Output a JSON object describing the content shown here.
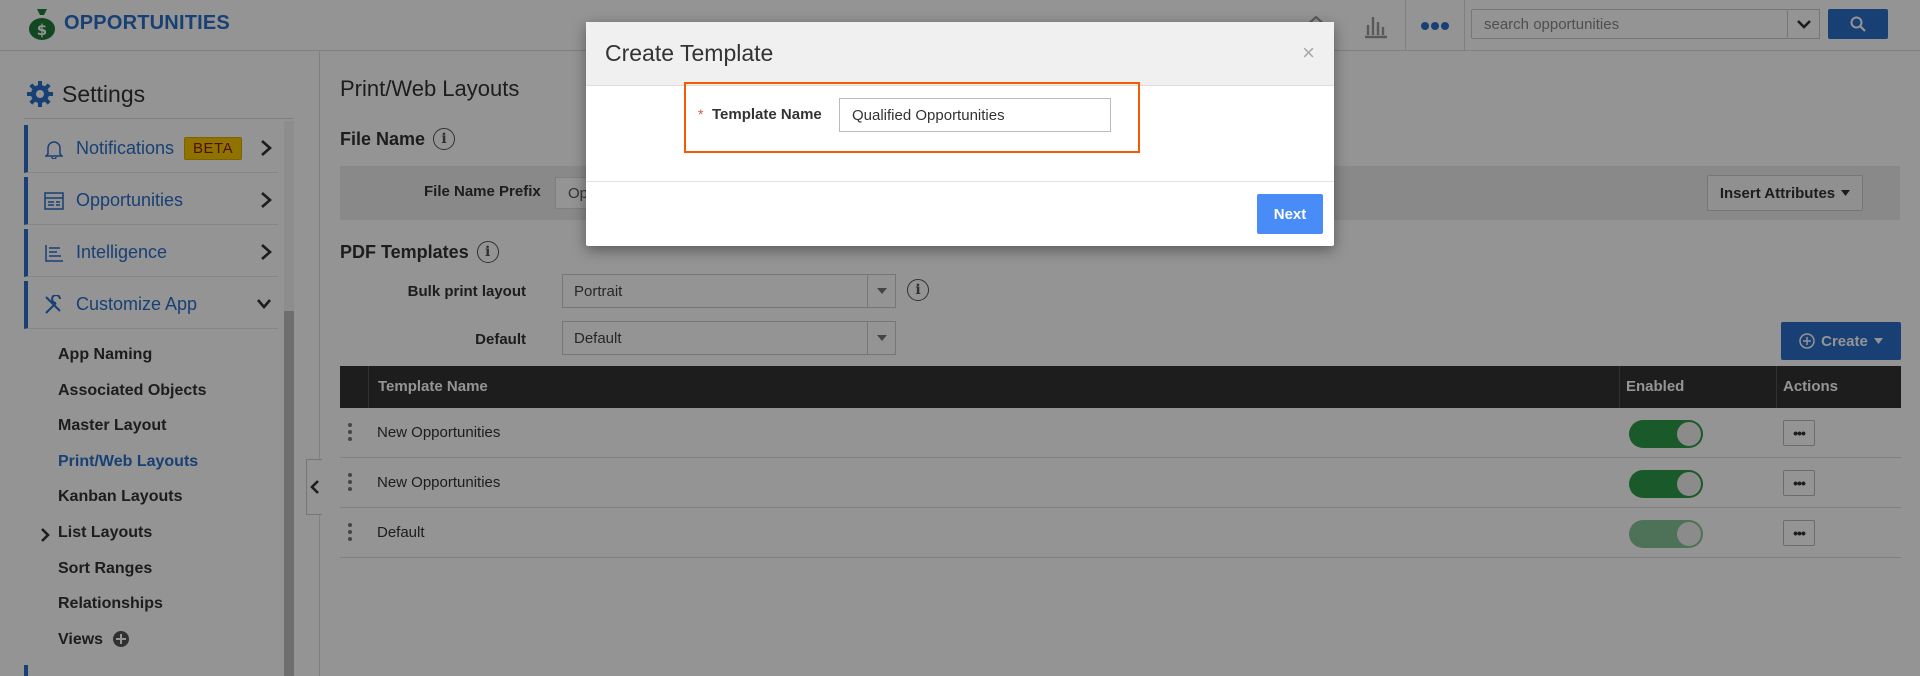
{
  "header": {
    "app_title": "OPPORTUNITIES",
    "search_placeholder": "search opportunities",
    "accent_color": "#2a6fc9"
  },
  "sidebar": {
    "title": "Settings",
    "items": [
      {
        "label": "Notifications",
        "badge": "BETA",
        "icon": "bell-icon",
        "expanded": false
      },
      {
        "label": "Opportunities",
        "icon": "table-icon",
        "expanded": false
      },
      {
        "label": "Intelligence",
        "icon": "lines-icon",
        "expanded": false
      },
      {
        "label": "Customize App",
        "icon": "tools-icon",
        "expanded": true
      }
    ],
    "sub_items": [
      {
        "label": "App Naming"
      },
      {
        "label": "Associated Objects"
      },
      {
        "label": "Master Layout"
      },
      {
        "label": "Print/Web Layouts",
        "active": true
      },
      {
        "label": "Kanban Layouts"
      },
      {
        "label": "List Layouts",
        "has_children": true
      },
      {
        "label": "Sort Ranges"
      },
      {
        "label": "Relationships"
      },
      {
        "label": "Views",
        "has_add": true
      }
    ]
  },
  "main": {
    "page_title": "Print/Web Layouts",
    "file_name": {
      "section_title": "File Name",
      "prefix_label": "File Name Prefix",
      "prefix_value": "Op",
      "insert_attributes_label": "Insert Attributes"
    },
    "pdf_templates": {
      "section_title": "PDF Templates",
      "bulk_print_label": "Bulk print layout",
      "bulk_print_value": "Portrait",
      "default_label": "Default",
      "default_value": "Default",
      "create_label": "Create"
    },
    "table": {
      "columns": [
        "Template Name",
        "Enabled",
        "Actions"
      ],
      "rows": [
        {
          "name": "New Opportunities",
          "enabled": true,
          "actions": "•••"
        },
        {
          "name": "New Opportunities",
          "enabled": true,
          "actions": "•••"
        },
        {
          "name": "Default",
          "enabled": true,
          "locked": true,
          "actions": "•••"
        }
      ]
    }
  },
  "modal": {
    "title": "Create Template",
    "close_label": "×",
    "required_marker": "*",
    "field_label": "Template Name",
    "field_value": "Qualified Opportunities",
    "next_label": "Next",
    "highlight_color": "#f25c05"
  }
}
